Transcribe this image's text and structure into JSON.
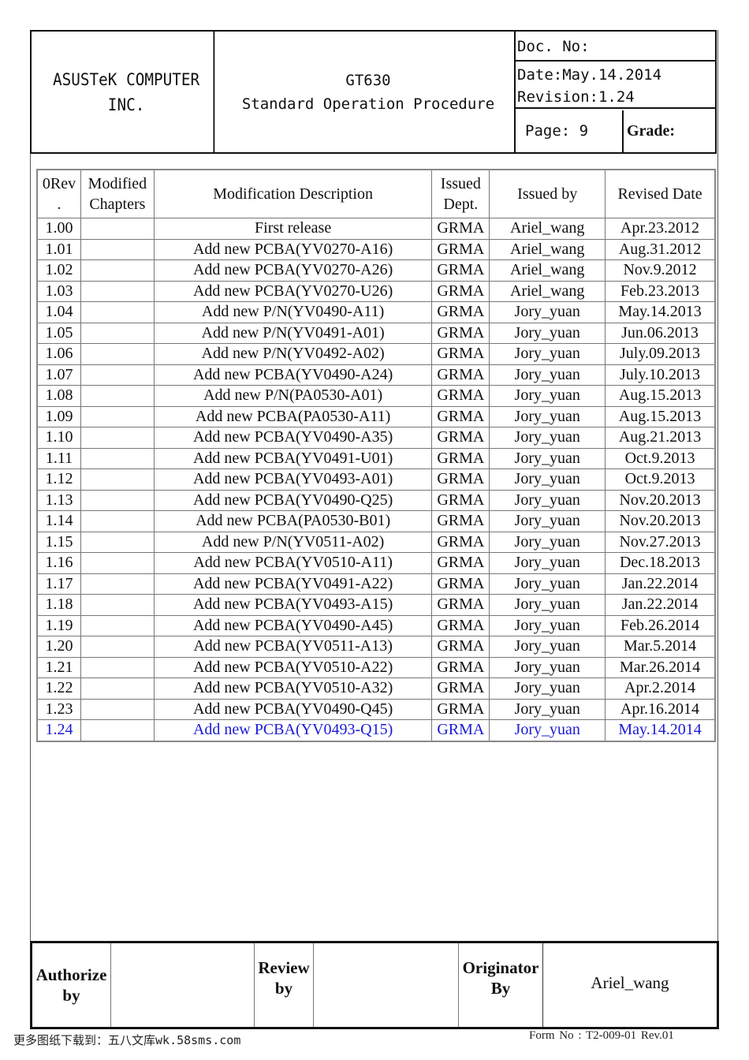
{
  "header": {
    "company": "ASUSTeK COMPUTER INC.",
    "company_line1": "ASUSTeK COMPUTER",
    "company_line2": "INC.",
    "product": "GT630",
    "doc_type": "Standard Operation Procedure",
    "doc_no_label": "Doc. No:",
    "date_label": "Date:May.14.2014",
    "revision_label": "Revision:1.24",
    "page_label": "Page: 9",
    "grade_label": "Grade:"
  },
  "revision_table": {
    "headers": {
      "rev": "0Rev\n.",
      "rev_line1": "0Rev",
      "rev_line2": ".",
      "chapters_line1": "Modified",
      "chapters_line2": "Chapters",
      "description": "Modification Description",
      "dept_line1": "Issued",
      "dept_line2": "Dept.",
      "issued_by": "Issued by",
      "revised_date": "Revised Date"
    },
    "rows": [
      {
        "rev": "1.00",
        "chapters": "",
        "description": "First release",
        "dept": "GRMA",
        "issued_by": "Ariel_wang",
        "date": "Apr.23.2012"
      },
      {
        "rev": "1.01",
        "chapters": "",
        "description": "Add new PCBA(YV0270-A16)",
        "dept": "GRMA",
        "issued_by": "Ariel_wang",
        "date": "Aug.31.2012"
      },
      {
        "rev": "1.02",
        "chapters": "",
        "description": "Add new PCBA(YV0270-A26)",
        "dept": "GRMA",
        "issued_by": "Ariel_wang",
        "date": "Nov.9.2012"
      },
      {
        "rev": "1.03",
        "chapters": "",
        "description": "Add new PCBA(YV0270-U26)",
        "dept": "GRMA",
        "issued_by": "Ariel_wang",
        "date": "Feb.23.2013"
      },
      {
        "rev": "1.04",
        "chapters": "",
        "description": "Add new P/N(YV0490-A11)",
        "dept": "GRMA",
        "issued_by": "Jory_yuan",
        "date": "May.14.2013"
      },
      {
        "rev": "1.05",
        "chapters": "",
        "description": "Add new P/N(YV0491-A01)",
        "dept": "GRMA",
        "issued_by": "Jory_yuan",
        "date": "Jun.06.2013"
      },
      {
        "rev": "1.06",
        "chapters": "",
        "description": "Add new P/N(YV0492-A02)",
        "dept": "GRMA",
        "issued_by": "Jory_yuan",
        "date": "July.09.2013"
      },
      {
        "rev": "1.07",
        "chapters": "",
        "description": "Add new PCBA(YV0490-A24)",
        "dept": "GRMA",
        "issued_by": "Jory_yuan",
        "date": "July.10.2013"
      },
      {
        "rev": "1.08",
        "chapters": "",
        "description": "Add new P/N(PA0530-A01)",
        "dept": "GRMA",
        "issued_by": "Jory_yuan",
        "date": "Aug.15.2013"
      },
      {
        "rev": "1.09",
        "chapters": "",
        "description": "Add new PCBA(PA0530-A11)",
        "dept": "GRMA",
        "issued_by": "Jory_yuan",
        "date": "Aug.15.2013"
      },
      {
        "rev": "1.10",
        "chapters": "",
        "description": "Add new PCBA(YV0490-A35)",
        "dept": "GRMA",
        "issued_by": "Jory_yuan",
        "date": "Aug.21.2013"
      },
      {
        "rev": "1.11",
        "chapters": "",
        "description": "Add new PCBA(YV0491-U01)",
        "dept": "GRMA",
        "issued_by": "Jory_yuan",
        "date": "Oct.9.2013"
      },
      {
        "rev": "1.12",
        "chapters": "",
        "description": "Add new PCBA(YV0493-A01)",
        "dept": "GRMA",
        "issued_by": "Jory_yuan",
        "date": "Oct.9.2013"
      },
      {
        "rev": "1.13",
        "chapters": "",
        "description": "Add new PCBA(YV0490-Q25)",
        "dept": "GRMA",
        "issued_by": "Jory_yuan",
        "date": "Nov.20.2013"
      },
      {
        "rev": "1.14",
        "chapters": "",
        "description": "Add new PCBA(PA0530-B01)",
        "dept": "GRMA",
        "issued_by": "Jory_yuan",
        "date": "Nov.20.2013"
      },
      {
        "rev": "1.15",
        "chapters": "",
        "description": "Add new P/N(YV0511-A02)",
        "dept": "GRMA",
        "issued_by": "Jory_yuan",
        "date": "Nov.27.2013"
      },
      {
        "rev": "1.16",
        "chapters": "",
        "description": "Add new PCBA(YV0510-A11)",
        "dept": "GRMA",
        "issued_by": "Jory_yuan",
        "date": "Dec.18.2013"
      },
      {
        "rev": "1.17",
        "chapters": "",
        "description": "Add new PCBA(YV0491-A22)",
        "dept": "GRMA",
        "issued_by": "Jory_yuan",
        "date": "Jan.22.2014"
      },
      {
        "rev": "1.18",
        "chapters": "",
        "description": "Add new PCBA(YV0493-A15)",
        "dept": "GRMA",
        "issued_by": "Jory_yuan",
        "date": "Jan.22.2014"
      },
      {
        "rev": "1.19",
        "chapters": "",
        "description": "Add new PCBA(YV0490-A45)",
        "dept": "GRMA",
        "issued_by": "Jory_yuan",
        "date": "Feb.26.2014"
      },
      {
        "rev": "1.20",
        "chapters": "",
        "description": "Add new PCBA(YV0511-A13)",
        "dept": "GRMA",
        "issued_by": "Jory_yuan",
        "date": "Mar.5.2014"
      },
      {
        "rev": "1.21",
        "chapters": "",
        "description": "Add new PCBA(YV0510-A22)",
        "dept": "GRMA",
        "issued_by": "Jory_yuan",
        "date": "Mar.26.2014"
      },
      {
        "rev": "1.22",
        "chapters": "",
        "description": "Add new PCBA(YV0510-A32)",
        "dept": "GRMA",
        "issued_by": "Jory_yuan",
        "date": "Apr.2.2014"
      },
      {
        "rev": "1.23",
        "chapters": "",
        "description": "Add new PCBA(YV0490-Q45)",
        "dept": "GRMA",
        "issued_by": "Jory_yuan",
        "date": "Apr.16.2014"
      },
      {
        "rev": "1.24",
        "chapters": "",
        "description": "Add new PCBA(YV0493-Q15)",
        "dept": "GRMA",
        "issued_by": "Jory_yuan",
        "date": "May.14.2014",
        "highlight": true
      }
    ],
    "highlight_color": "#1a1ad6"
  },
  "signoff": {
    "authorize_line1": "Authorize",
    "authorize_line2": "by",
    "authorize_value": "",
    "review_line1": "Review",
    "review_line2": "by",
    "review_value": "",
    "originator_line1": "Originator",
    "originator_line2": "By",
    "originator_value": "Ariel_wang"
  },
  "footer": {
    "watermark": "更多图纸下载到：五八文库wk.58sms.com",
    "form_no": "Form No : T2-009-01 Rev.01"
  }
}
